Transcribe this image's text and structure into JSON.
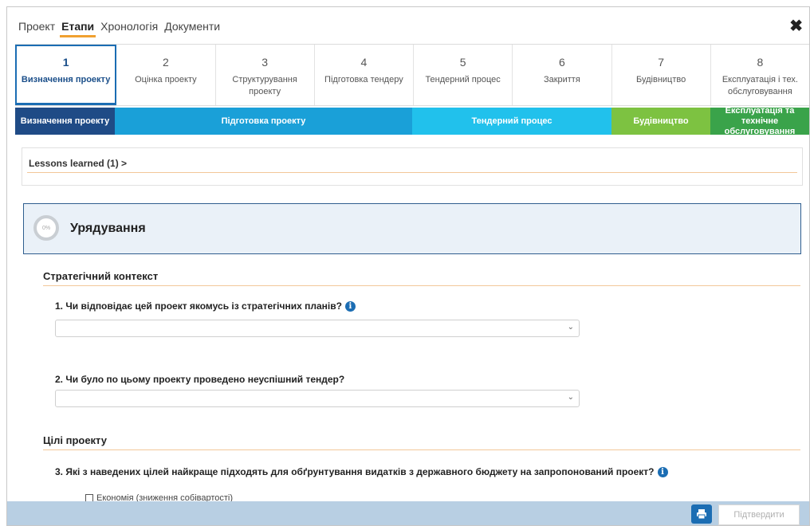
{
  "top_tabs": [
    "Проект",
    "Етапи",
    "Хронологія",
    "Документи"
  ],
  "active_top_tab": "Етапи",
  "close_label": "✖",
  "steps": [
    {
      "num": "1",
      "label": "Визначення проекту"
    },
    {
      "num": "2",
      "label": "Оцінка проекту"
    },
    {
      "num": "3",
      "label": "Структурування проекту"
    },
    {
      "num": "4",
      "label": "Підготовка тендеру"
    },
    {
      "num": "5",
      "label": "Тендерний процес"
    },
    {
      "num": "6",
      "label": "Закриття"
    },
    {
      "num": "7",
      "label": "Будівництво"
    },
    {
      "num": "8",
      "label": "Експлуатація і тех. обслуговування"
    }
  ],
  "phases": [
    "Визначення проекту",
    "Підготовка проекту",
    "Тендерний процес",
    "Будівництво",
    "Експлуатація та технічне обслуговування"
  ],
  "phase_colors": [
    "#1f4b86",
    "#1aa0d8",
    "#21c1ec",
    "#7dc241",
    "#3aa34a"
  ],
  "lessons_label": "Lessons learned (1) >",
  "section": {
    "title": "Урядування",
    "progress_label": "0%"
  },
  "strategic": {
    "heading": "Стратегічний контекст",
    "q1": "1. Чи відповідає цей проект якомусь із стратегічних планів?",
    "q2": "2. Чи було по цьому проекту проведено неуспішний тендер?"
  },
  "goals": {
    "heading": "Цілі проекту",
    "q3": "3. Які з наведених цілей найкраще підходять для обґрунтування видатків з державного бюджету на запропонований проект?",
    "option1": "Економія (зниження собівартості)"
  },
  "footer": {
    "confirm_label": "Підтвердити"
  },
  "accent_color": "#1b6db3"
}
